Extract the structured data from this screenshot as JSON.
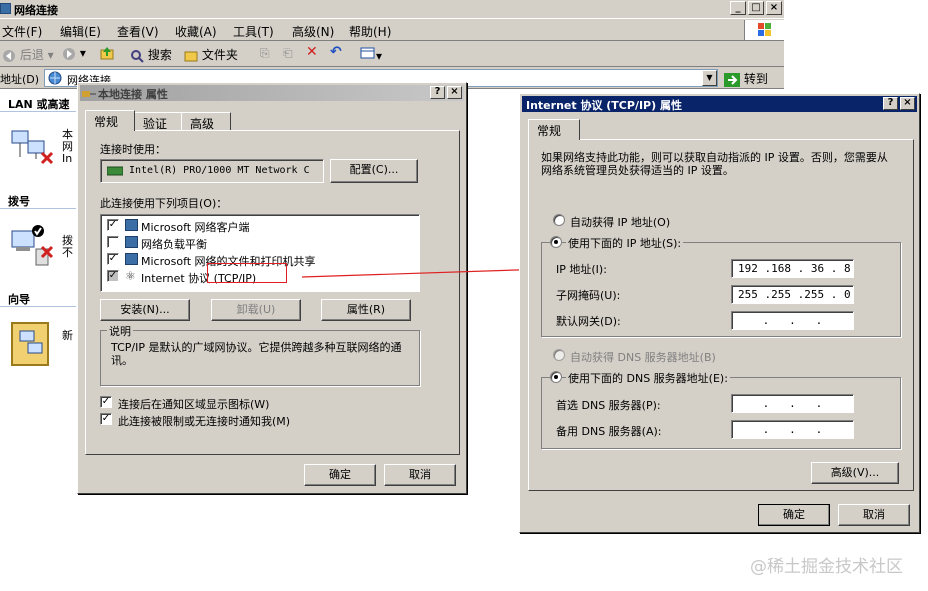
{
  "main_window": {
    "title": "网络连接",
    "menu": [
      "文件(F)",
      "编辑(E)",
      "查看(V)",
      "收藏(A)",
      "工具(T)",
      "高级(N)",
      "帮助(H)"
    ],
    "toolbar": {
      "back": "后退",
      "search": "搜索",
      "folders": "文件夹"
    },
    "address": {
      "label": "地址(D)",
      "value": "网络连接",
      "go": "转到"
    },
    "left_pane": {
      "lan_header": "LAN 或高速",
      "lan_item": "本\n网\nIn",
      "dialup_header": "拨号",
      "dialup_item": "拨\n不",
      "wizard_header": "向导",
      "wizard_item": "新"
    }
  },
  "local_props": {
    "title": "本地连接 属性",
    "tabs": [
      "常规",
      "验证",
      "高级"
    ],
    "connect_using_label": "连接时使用：",
    "adapter": "Intel(R) PRO/1000 MT Network C",
    "configure_button": "配置(C)...",
    "items_label": "此连接使用下列项目(O)：",
    "items": [
      {
        "label": "Microsoft 网络客户端",
        "checked": true
      },
      {
        "label": "网络负载平衡",
        "checked": false
      },
      {
        "label": "Microsoft 网络的文件和打印机共享",
        "checked": true
      },
      {
        "label": "Internet 协议 (TCP/IP)",
        "checked": true
      }
    ],
    "install_button": "安装(N)...",
    "uninstall_button": "卸载(U)",
    "properties_button": "属性(R)",
    "description_title": "说明",
    "description": "TCP/IP 是默认的广域网协议。它提供跨越多种互联网络的通讯。",
    "show_icon_checkbox": "连接后在通知区域显示图标(W)",
    "notify_checkbox": "此连接被限制或无连接时通知我(M)",
    "ok_button": "确定",
    "cancel_button": "取消"
  },
  "tcpip_props": {
    "title": "Internet 协议 (TCP/IP) 属性",
    "tab": "常规",
    "intro": "如果网络支持此功能，则可以获取自动指派的 IP 设置。否则，您需要从网络系统管理员处获得适当的 IP 设置。",
    "auto_ip_radio": "自动获得 IP 地址(O)",
    "manual_ip_radio": "使用下面的 IP 地址(S):",
    "ip_label": "IP 地址(I):",
    "ip_value": "192 .168 . 36 . 8",
    "mask_label": "子网掩码(U):",
    "mask_value": "255 .255 .255 . 0",
    "gateway_label": "默认网关(D):",
    "gateway_value": " .   .   . ",
    "auto_dns_radio": "自动获得 DNS 服务器地址(B)",
    "manual_dns_radio": "使用下面的 DNS 服务器地址(E):",
    "dns1_label": "首选 DNS 服务器(P):",
    "dns1_value": " .   .   . ",
    "dns2_label": "备用 DNS 服务器(A):",
    "dns2_value": " .   .   . ",
    "advanced_button": "高级(V)...",
    "ok_button": "确定",
    "cancel_button": "取消"
  },
  "watermark": "@稀土掘金技术社区",
  "colors": {
    "annotation": "#e02020",
    "title_active": "#0a246a",
    "face": "#d4d0c8"
  }
}
